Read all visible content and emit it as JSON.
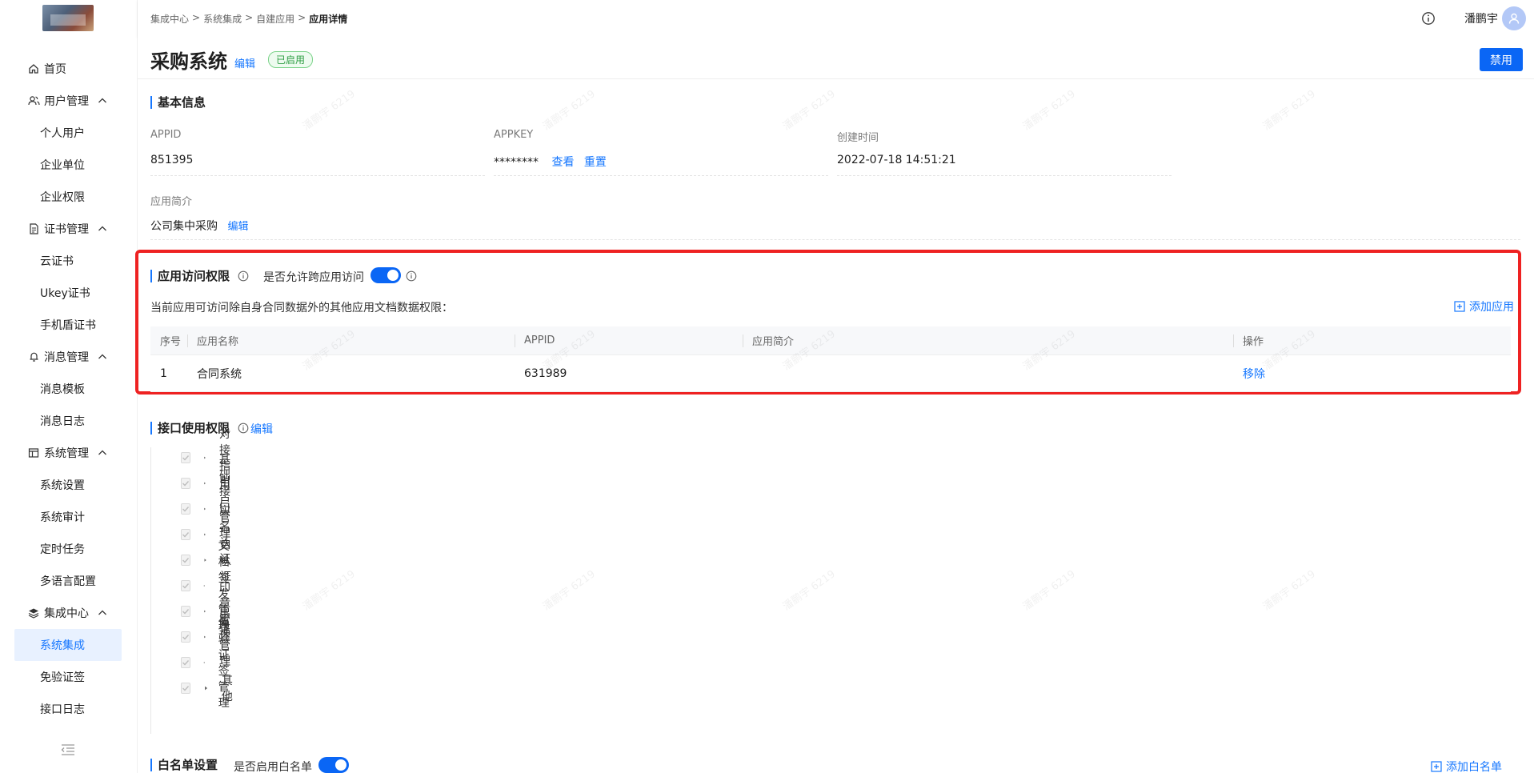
{
  "sidebar": {
    "items": [
      {
        "label": "首页",
        "type": "top",
        "icon": "home-icon"
      },
      {
        "label": "用户管理",
        "type": "group",
        "icon": "users-icon"
      },
      {
        "label": "个人用户",
        "type": "sub"
      },
      {
        "label": "企业单位",
        "type": "sub"
      },
      {
        "label": "企业权限",
        "type": "sub"
      },
      {
        "label": "证书管理",
        "type": "group",
        "icon": "certificate-icon"
      },
      {
        "label": "云证书",
        "type": "sub"
      },
      {
        "label": "Ukey证书",
        "type": "sub"
      },
      {
        "label": "手机盾证书",
        "type": "sub"
      },
      {
        "label": "消息管理",
        "type": "group",
        "icon": "bell-icon"
      },
      {
        "label": "消息模板",
        "type": "sub"
      },
      {
        "label": "消息日志",
        "type": "sub"
      },
      {
        "label": "系统管理",
        "type": "group",
        "icon": "system-icon"
      },
      {
        "label": "系统设置",
        "type": "sub"
      },
      {
        "label": "系统审计",
        "type": "sub"
      },
      {
        "label": "定时任务",
        "type": "sub"
      },
      {
        "label": "多语言配置",
        "type": "sub"
      },
      {
        "label": "集成中心",
        "type": "group",
        "icon": "layers-icon"
      },
      {
        "label": "系统集成",
        "type": "sub",
        "active": true
      },
      {
        "label": "免验证签",
        "type": "sub"
      },
      {
        "label": "接口日志",
        "type": "sub"
      }
    ]
  },
  "header": {
    "breadcrumb": [
      "集成中心",
      "系统集成",
      "自建应用",
      "应用详情"
    ],
    "breadcrumb_sep": ">",
    "user_name": "潘鹏宇"
  },
  "page": {
    "title": "采购系统",
    "title_edit": "编辑",
    "status": "已启用",
    "disable_button": "禁用"
  },
  "basic_info": {
    "section_title": "基本信息",
    "appid_label": "APPID",
    "appid_value": "851395",
    "appkey_label": "APPKEY",
    "appkey_value": "********",
    "appkey_view": "查看",
    "appkey_reset": "重置",
    "created_label": "创建时间",
    "created_value": "2022-07-18 14:51:21",
    "intro_label": "应用简介",
    "intro_value": "公司集中采购",
    "intro_edit": "编辑"
  },
  "access": {
    "section_title": "应用访问权限",
    "cross_label": "是否允许跨应用访问",
    "cross_enabled": true,
    "description": "当前应用可访问除自身合同数据外的其他应用文档数据权限：",
    "add_button": "添加应用",
    "columns": [
      "序号",
      "应用名称",
      "APPID",
      "应用简介",
      "操作"
    ],
    "rows": [
      {
        "no": "1",
        "name": "合同系统",
        "appid": "631989",
        "intro": "",
        "action": "移除"
      }
    ]
  },
  "api": {
    "section_title": "接口使用权限",
    "edit": "编辑",
    "items": [
      "对接指引",
      "基础接口",
      "用户管理",
      "实名认证",
      "自认证",
      "文档签发管理",
      "印章管理",
      "出证管理",
      "免验证签管理",
      "其他"
    ]
  },
  "whitelist": {
    "section_title": "白名单设置",
    "enable_label": "是否启用白名单",
    "enabled": true,
    "add_button": "添加白名单"
  },
  "watermark_text": "潘鹏宇 6219",
  "colors": {
    "primary": "#1677ff",
    "button": "#0a66f5",
    "highlight_border": "#ee2222",
    "status_green": "#2f9e44"
  }
}
